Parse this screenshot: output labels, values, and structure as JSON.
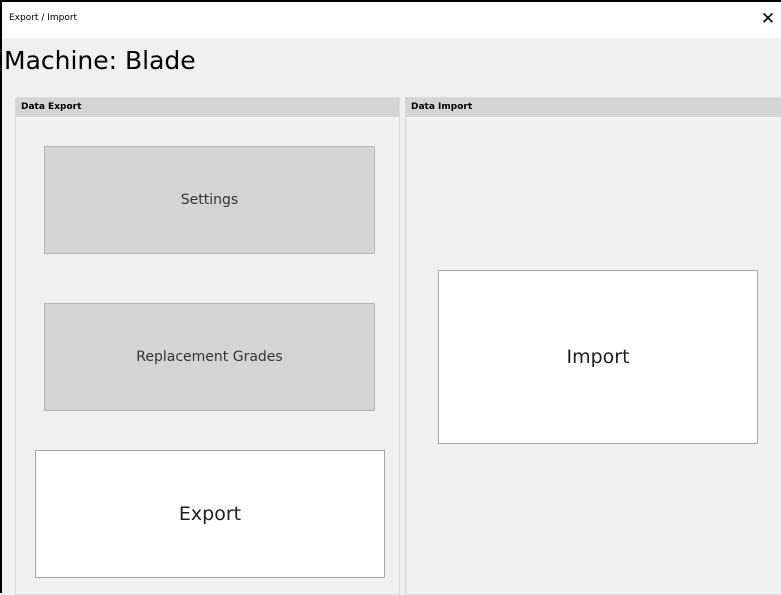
{
  "window": {
    "title": "Export / Import",
    "close_glyph": "✕",
    "close_icon": "close-icon"
  },
  "machine_title": "Machine: Blade",
  "export_panel": {
    "header": "Data Export",
    "settings_button": "Settings",
    "replacement_grades_button": "Replacement Grades",
    "export_button": "Export"
  },
  "import_panel": {
    "header": "Data Import",
    "import_button": "Import"
  },
  "colors": {
    "background": "#f0f0f0",
    "panel_header": "#d4d4d4",
    "gray_button": "#d4d4d4",
    "white_button": "#ffffff"
  }
}
